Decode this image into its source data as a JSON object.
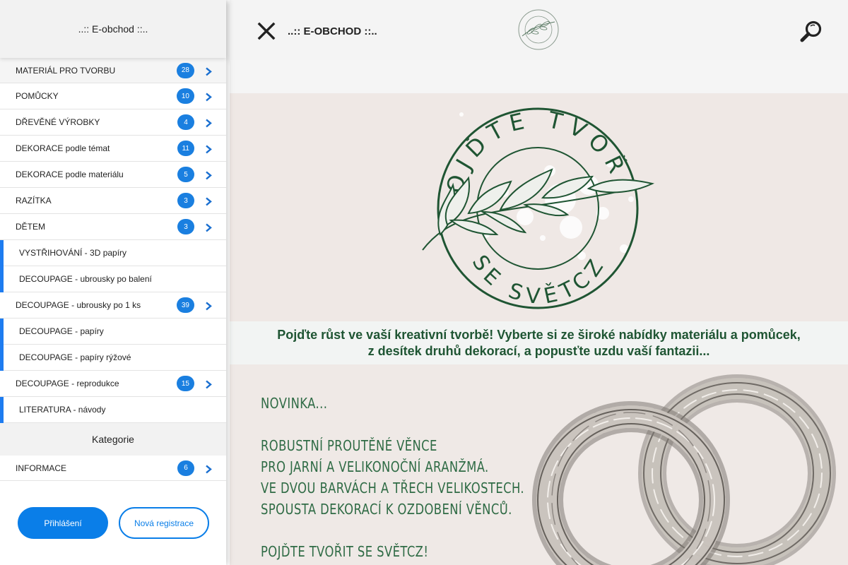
{
  "sidebar": {
    "header_title": "..:: E-obchod ::..",
    "items": [
      {
        "label": "MATERIÁL PRO TVORBU",
        "count": "28"
      },
      {
        "label": "POMŮCKY",
        "count": "10"
      },
      {
        "label": "DŘEVĚNÉ VÝROBKY",
        "count": "4"
      },
      {
        "label": "DEKORACE podle témat",
        "count": "11"
      },
      {
        "label": "DEKORACE podle materiálu",
        "count": "5"
      },
      {
        "label": "RAZÍTKA",
        "count": "3"
      },
      {
        "label": "DĚTEM",
        "count": "3"
      },
      {
        "label": "VYSTŘIHOVÁNÍ - 3D papíry"
      },
      {
        "label": "DECOUPAGE - ubrousky po balení"
      },
      {
        "label": "DECOUPAGE - ubrousky po 1 ks",
        "count": "39"
      },
      {
        "label": "DECOUPAGE - papíry"
      },
      {
        "label": "DECOUPAGE - papíry rýžové"
      },
      {
        "label": "DECOUPAGE - reprodukce",
        "count": "15"
      },
      {
        "label": "LITERATURA - návody"
      }
    ],
    "category_heading": "Kategorie",
    "info_item": {
      "label": "INFORMACE",
      "count": "6"
    },
    "login_label": "Přihlášení",
    "register_label": "Nová registrace"
  },
  "topbar": {
    "title": "..:: E-OBCHOD ::..",
    "close_icon": "close-icon",
    "search_icon": "search-icon"
  },
  "hero": {
    "logo_top_text": "POJĎTE TVOŘIT",
    "logo_bottom_text": "SE SVĚTCZ"
  },
  "slogan": {
    "line1": "Pojďte růst ve vaší kreativní tvorbě! Vyberte si ze široké nabídky materiálu a pomůcek,",
    "line2": "z desítek druhů dekorací, a popusťte uzdu vaší fantazii..."
  },
  "promo": {
    "lines": [
      "NOVINKA...",
      "",
      "ROBUSTNÍ PROUTĚNÉ VĚNCE",
      "PRO JARNÍ A VELIKONOČNÍ ARANŽMÁ.",
      "VE DVOU BARVÁCH A TŘECH VELIKOSTECH.",
      "SPOUSTA DEKORACÍ K OZDOBENÍ VĚNCŮ.",
      "",
      "POJĎTE TVOŘIT SE SVĚTCZ!"
    ]
  },
  "colors": {
    "accent_blue": "#1a7fe0",
    "brand_green": "#1f5533",
    "promo_green": "#2f6b45"
  }
}
